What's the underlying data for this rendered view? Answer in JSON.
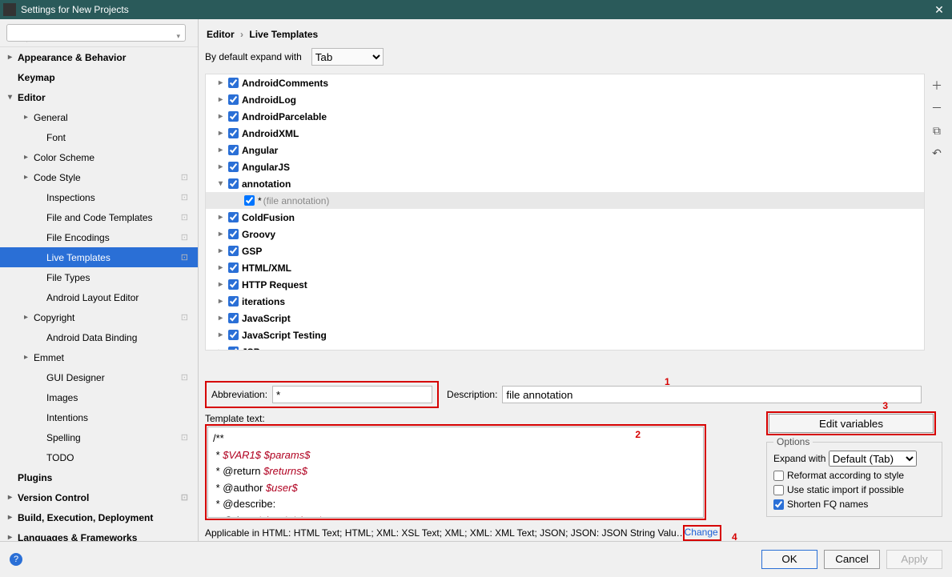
{
  "window": {
    "title": "Settings for New Projects"
  },
  "breadcrumb": {
    "parent": "Editor",
    "current": "Live Templates"
  },
  "expand": {
    "label": "By default expand with",
    "value": "Tab"
  },
  "sidebar": {
    "items": [
      {
        "label": "Appearance & Behavior",
        "d": 0,
        "exp": true,
        "bold": true
      },
      {
        "label": "Keymap",
        "d": 0,
        "bold": true
      },
      {
        "label": "Editor",
        "d": 0,
        "exp": true,
        "bold": true,
        "open": true
      },
      {
        "label": "General",
        "d": 1,
        "exp": true
      },
      {
        "label": "Font",
        "d": 2
      },
      {
        "label": "Color Scheme",
        "d": 1,
        "exp": true
      },
      {
        "label": "Code Style",
        "d": 1,
        "exp": true,
        "cfg": true
      },
      {
        "label": "Inspections",
        "d": 2,
        "cfg": true
      },
      {
        "label": "File and Code Templates",
        "d": 2,
        "cfg": true
      },
      {
        "label": "File Encodings",
        "d": 2,
        "cfg": true
      },
      {
        "label": "Live Templates",
        "d": 2,
        "cfg": true,
        "selected": true
      },
      {
        "label": "File Types",
        "d": 2
      },
      {
        "label": "Android Layout Editor",
        "d": 2
      },
      {
        "label": "Copyright",
        "d": 1,
        "exp": true,
        "cfg": true
      },
      {
        "label": "Android Data Binding",
        "d": 2
      },
      {
        "label": "Emmet",
        "d": 1,
        "exp": true
      },
      {
        "label": "GUI Designer",
        "d": 2,
        "cfg": true
      },
      {
        "label": "Images",
        "d": 2
      },
      {
        "label": "Intentions",
        "d": 2
      },
      {
        "label": "Spelling",
        "d": 2,
        "cfg": true
      },
      {
        "label": "TODO",
        "d": 2
      },
      {
        "label": "Plugins",
        "d": 0,
        "bold": true
      },
      {
        "label": "Version Control",
        "d": 0,
        "exp": true,
        "bold": true,
        "cfg": true
      },
      {
        "label": "Build, Execution, Deployment",
        "d": 0,
        "exp": true,
        "bold": true
      },
      {
        "label": "Languages & Frameworks",
        "d": 0,
        "exp": true,
        "bold": true
      }
    ]
  },
  "templateGroups": [
    {
      "label": "AndroidComments"
    },
    {
      "label": "AndroidLog"
    },
    {
      "label": "AndroidParcelable"
    },
    {
      "label": "AndroidXML"
    },
    {
      "label": "Angular"
    },
    {
      "label": "AngularJS"
    },
    {
      "label": "annotation",
      "open": true,
      "leaf": {
        "name": "*",
        "desc": "(file annotation)"
      }
    },
    {
      "label": "ColdFusion"
    },
    {
      "label": "Groovy"
    },
    {
      "label": "GSP"
    },
    {
      "label": "HTML/XML"
    },
    {
      "label": "HTTP Request"
    },
    {
      "label": "iterations"
    },
    {
      "label": "JavaScript"
    },
    {
      "label": "JavaScript Testing"
    },
    {
      "label": "JSP"
    }
  ],
  "form": {
    "abbr_label": "Abbreviation:",
    "abbr_value": "*",
    "desc_label": "Description:",
    "desc_value": "file annotation",
    "tt_label": "Template text:",
    "edit_vars": "Edit variables",
    "options_legend": "Options",
    "expand_with_label": "Expand with",
    "expand_with_value": "Default (Tab)",
    "opt_reformat": "Reformat according to style",
    "opt_static": "Use static import if possible",
    "opt_shorten": "Shorten FQ names",
    "applicable": "Applicable in HTML: HTML Text; HTML; XML: XSL Text; XML; XML: XML Text; JSON; JSON: JSON String Valu…",
    "change": "Change"
  },
  "code": {
    "l1": "/**",
    "l2_a": " * ",
    "l2_v1": "$VAR1$",
    "l2_b": " ",
    "l2_v2": "$params$",
    "l3_a": " * @return ",
    "l3_v": "$returns$",
    "l4_a": " * @author ",
    "l4_v": "$user$",
    "l5": " * @describe:",
    "l6_a": " * @date ",
    "l6_v1": "$date$",
    "l6_b": " ",
    "l6_v2": "$time$"
  },
  "annotations": {
    "n1": "1",
    "n2": "2",
    "n3": "3",
    "n4": "4"
  },
  "footer": {
    "ok": "OK",
    "cancel": "Cancel",
    "apply": "Apply"
  }
}
